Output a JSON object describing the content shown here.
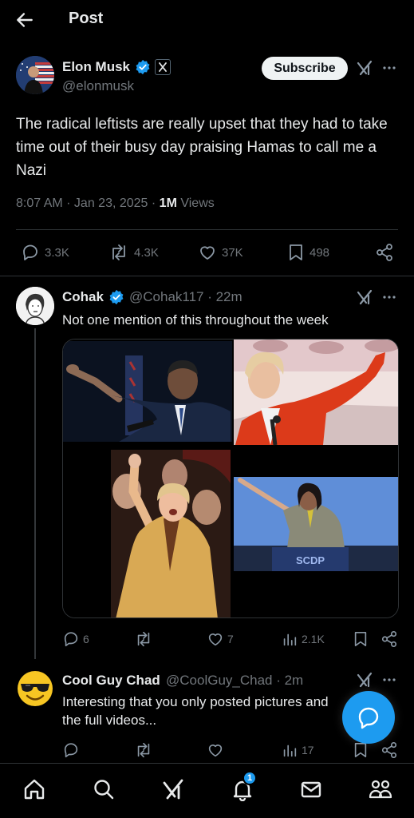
{
  "header": {
    "title": "Post"
  },
  "post": {
    "author_name": "Elon Musk",
    "author_handle": "@elonmusk",
    "subscribe_label": "Subscribe",
    "text": "The radical leftists are really upset that they had to take time out of their busy day praising Hamas to call me a Nazi",
    "timestamp": "8:07 AM · Jan 23, 2025 · ",
    "views_count": "1M",
    "views_label": " Views",
    "replies": "3.3K",
    "reposts": "4.3K",
    "likes": "37K",
    "bookmarks": "498"
  },
  "reply1": {
    "author_name": "Cohak",
    "author_handle": "@Cohak117 · 22m",
    "text": "Not one mention of this throughout the week",
    "replies": "6",
    "likes": "7",
    "views": "2.1K",
    "image_text": "SCDP"
  },
  "reply2": {
    "author_name": "Cool Guy Chad",
    "author_handle": "@CoolGuy_Chad · 2m",
    "text_line1": "Interesting that you only posted pictures and",
    "text_line2": "the full videos...",
    "views": "17"
  },
  "bottom_nav": {
    "notifications_badge": "1"
  },
  "colors": {
    "accent": "#1d9bf0",
    "background": "#000000",
    "divider": "#2f3336",
    "muted": "#71767b"
  }
}
